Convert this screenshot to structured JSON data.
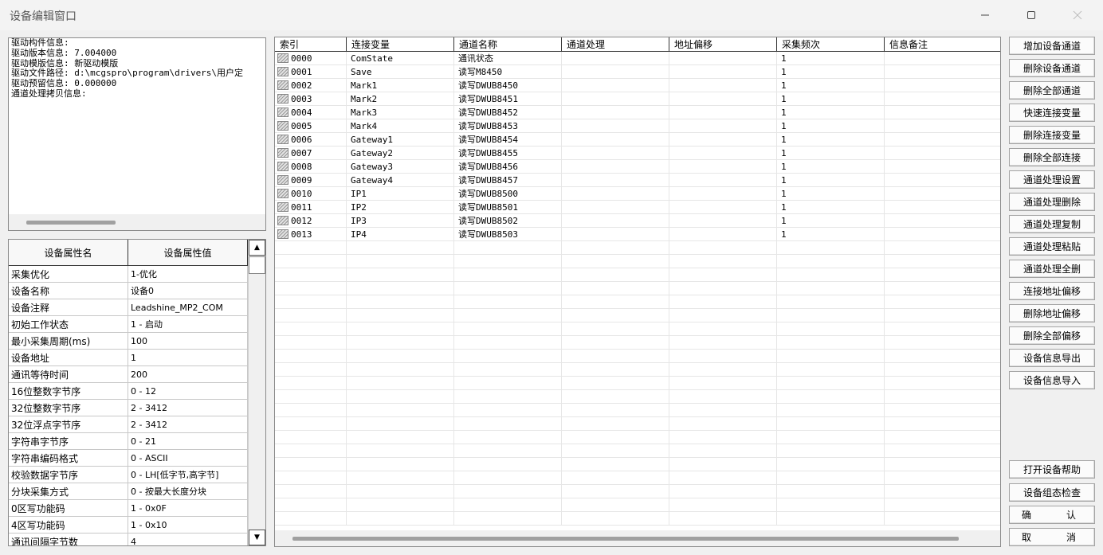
{
  "window": {
    "title": "设备编辑窗口"
  },
  "info_lines": [
    "驱动构件信息:",
    "驱动版本信息: 7.004000",
    "驱动模版信息: 新驱动模版",
    "驱动文件路径: d:\\mcgspro\\program\\drivers\\用户定",
    "驱动预留信息: 0.000000",
    "通道处理拷贝信息:"
  ],
  "properties": {
    "header": [
      "设备属性名",
      "设备属性值"
    ],
    "rows": [
      [
        "采集优化",
        "1-优化"
      ],
      [
        "设备名称",
        "设备0"
      ],
      [
        "设备注释",
        "Leadshine_MP2_COM"
      ],
      [
        "初始工作状态",
        "1 - 启动"
      ],
      [
        "最小采集周期(ms)",
        "100"
      ],
      [
        "设备地址",
        "1"
      ],
      [
        "通讯等待时间",
        "200"
      ],
      [
        "16位整数字节序",
        "0 - 12"
      ],
      [
        "32位整数字节序",
        "2 - 3412"
      ],
      [
        "32位浮点字节序",
        "2 - 3412"
      ],
      [
        "字符串字节序",
        "0 - 21"
      ],
      [
        "字符串编码格式",
        "0 - ASCII"
      ],
      [
        "校验数据字节序",
        "0 - LH[低字节,高字节]"
      ],
      [
        "分块采集方式",
        "0 - 按最大长度分块"
      ],
      [
        "0区写功能码",
        "1 - 0x0F"
      ],
      [
        "4区写功能码",
        "1 - 0x10"
      ],
      [
        "通讯间隔字节数",
        "4"
      ]
    ]
  },
  "channels": {
    "columns": [
      "索引",
      "连接变量",
      "通道名称",
      "通道处理",
      "地址偏移",
      "采集频次",
      "信息备注"
    ],
    "rows": [
      [
        "0000",
        "ComState",
        "通讯状态",
        "",
        "",
        "1",
        ""
      ],
      [
        "0001",
        "Save",
        "读写M8450",
        "",
        "",
        "1",
        ""
      ],
      [
        "0002",
        "Mark1",
        "读写DWUB8450",
        "",
        "",
        "1",
        ""
      ],
      [
        "0003",
        "Mark2",
        "读写DWUB8451",
        "",
        "",
        "1",
        ""
      ],
      [
        "0004",
        "Mark3",
        "读写DWUB8452",
        "",
        "",
        "1",
        ""
      ],
      [
        "0005",
        "Mark4",
        "读写DWUB8453",
        "",
        "",
        "1",
        ""
      ],
      [
        "0006",
        "Gateway1",
        "读写DWUB8454",
        "",
        "",
        "1",
        ""
      ],
      [
        "0007",
        "Gateway2",
        "读写DWUB8455",
        "",
        "",
        "1",
        ""
      ],
      [
        "0008",
        "Gateway3",
        "读写DWUB8456",
        "",
        "",
        "1",
        ""
      ],
      [
        "0009",
        "Gateway4",
        "读写DWUB8457",
        "",
        "",
        "1",
        ""
      ],
      [
        "0010",
        "IP1",
        "读写DWUB8500",
        "",
        "",
        "1",
        ""
      ],
      [
        "0011",
        "IP2",
        "读写DWUB8501",
        "",
        "",
        "1",
        ""
      ],
      [
        "0012",
        "IP3",
        "读写DWUB8502",
        "",
        "",
        "1",
        ""
      ],
      [
        "0013",
        "IP4",
        "读写DWUB8503",
        "",
        "",
        "1",
        ""
      ]
    ],
    "empty_rows": 21
  },
  "buttons": [
    {
      "name": "add-channel-button",
      "label": "增加设备通道"
    },
    {
      "name": "delete-channel-button",
      "label": "删除设备通道"
    },
    {
      "name": "delete-all-channels-button",
      "label": "删除全部通道"
    },
    {
      "name": "quick-connect-variable-button",
      "label": "快速连接变量"
    },
    {
      "name": "delete-connect-variable-button",
      "label": "删除连接变量"
    },
    {
      "name": "delete-all-connections-button",
      "label": "删除全部连接"
    },
    {
      "name": "channel-process-settings-button",
      "label": "通道处理设置"
    },
    {
      "name": "channel-process-delete-button",
      "label": "通道处理删除"
    },
    {
      "name": "channel-process-copy-button",
      "label": "通道处理复制"
    },
    {
      "name": "channel-process-paste-button",
      "label": "通道处理粘贴"
    },
    {
      "name": "channel-process-delete-all-button",
      "label": "通道处理全删"
    },
    {
      "name": "connect-address-offset-button",
      "label": "连接地址偏移"
    },
    {
      "name": "delete-address-offset-button",
      "label": "删除地址偏移"
    },
    {
      "name": "delete-all-offsets-button",
      "label": "删除全部偏移"
    },
    {
      "name": "export-device-info-button",
      "label": "设备信息导出"
    },
    {
      "name": "import-device-info-button",
      "label": "设备信息导入"
    }
  ],
  "bottom_buttons": {
    "help": "打开设备帮助",
    "check": "设备组态检查",
    "confirm": [
      "确",
      "认"
    ],
    "cancel": [
      "取",
      "消"
    ]
  },
  "icons": {
    "minimize": "minimize-icon",
    "maximize": "maximize-icon",
    "close": "close-icon",
    "scroll_up": "scroll-up-icon",
    "scroll_down": "scroll-down-icon",
    "row": "channel-row-icon"
  }
}
